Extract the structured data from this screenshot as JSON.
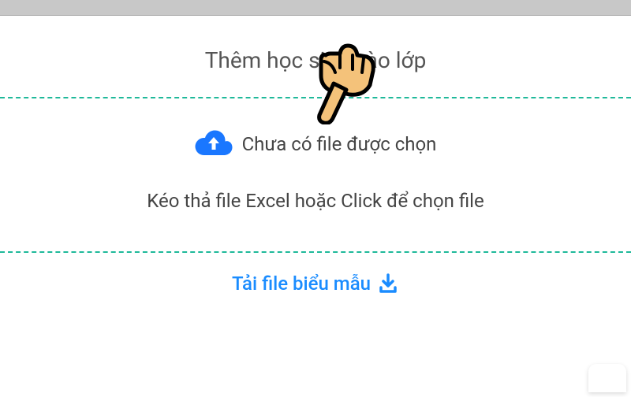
{
  "title": "Thêm học sinh vào lớp",
  "dropzone": {
    "file_status": "Chưa có file được chọn",
    "instruction": "Kéo thả file Excel hoặc Click để chọn file"
  },
  "download": {
    "label": "Tải file biểu mẫu"
  },
  "colors": {
    "accent_teal": "#1fb99a",
    "accent_blue": "#1a8cff",
    "cloud_blue": "#1a77ff"
  }
}
